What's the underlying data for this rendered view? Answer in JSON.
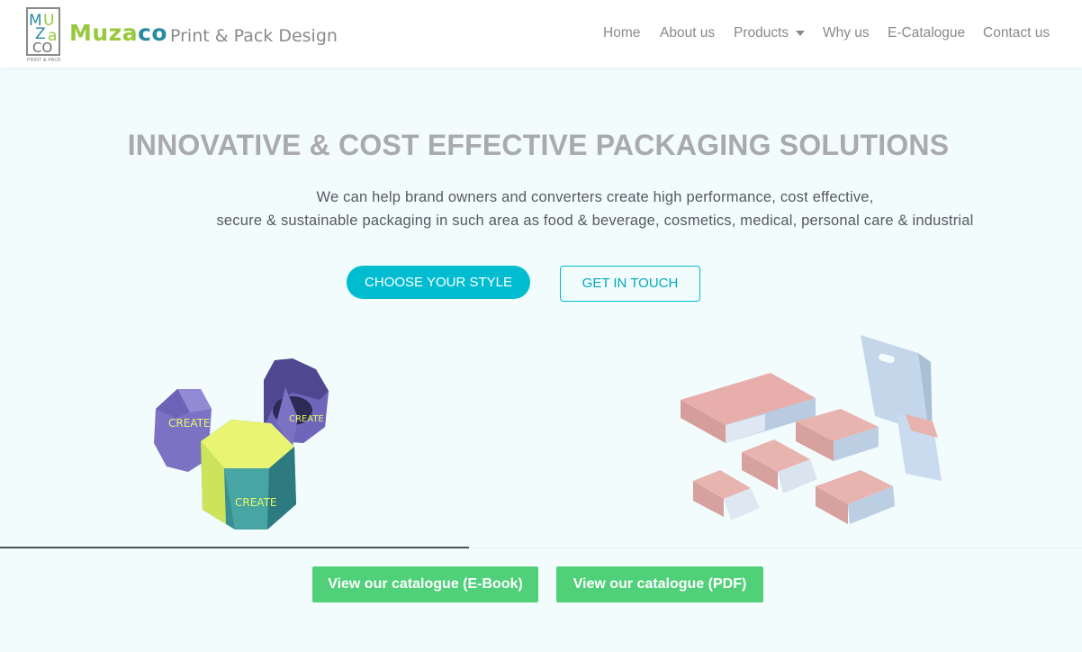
{
  "brand": {
    "logo_letters": [
      "M",
      "U",
      "Z",
      "a",
      "CO"
    ],
    "logo_small": "PRINT & PACK",
    "name_part1": "Muza",
    "name_part2": "co",
    "tagline": "Print & Pack Design"
  },
  "nav": {
    "home": "Home",
    "about": "About us",
    "products": "Products",
    "why": "Why us",
    "ecatalogue": "E-Catalogue",
    "contact": "Contact us"
  },
  "hero": {
    "title": "INNOVATIVE & COST EFFECTIVE PACKAGING SOLUTIONS",
    "line1": "We can help brand owners and converters create high performance, cost effective,",
    "line2": "secure & sustainable packaging in such area as food & beverage, cosmetics, medical, personal care & industrial",
    "choose_button": "CHOOSE YOUR STYLE",
    "touch_button": "GET IN TOUCH"
  },
  "products": {
    "box_label": "CREATE"
  },
  "catalogue": {
    "ebook_button": "View our catalogue (E-Book)",
    "pdf_button": "View our catalogue (PDF)"
  },
  "colors": {
    "accent": "#00bcd0",
    "brand_green": "#98c93c",
    "brand_teal": "#2a8aa0",
    "button_green": "#4fd079"
  }
}
